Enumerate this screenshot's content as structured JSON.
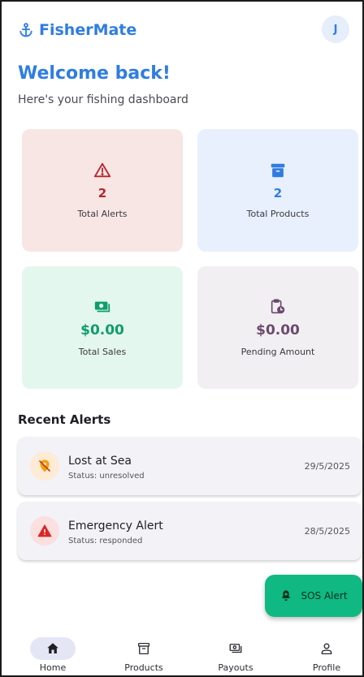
{
  "app": {
    "title": "FisherMate",
    "user_initial": "J"
  },
  "dashboard": {
    "welcome": "Welcome back!",
    "subtitle": "Here's your fishing dashboard"
  },
  "stats": [
    {
      "value": "2",
      "label": "Total Alerts",
      "icon": "warning-triangle-icon",
      "color": "#b3262c"
    },
    {
      "value": "2",
      "label": "Total Products",
      "icon": "archive-box-icon",
      "color": "#2f7de1"
    },
    {
      "value": "$0.00",
      "label": "Total Sales",
      "icon": "cash-icon",
      "color": "#0f9d6a"
    },
    {
      "value": "$0.00",
      "label": "Pending Amount",
      "icon": "clipboard-clock-icon",
      "color": "#6b4a6e"
    }
  ],
  "recent_alerts": {
    "title": "Recent Alerts",
    "items": [
      {
        "title": "Lost at Sea",
        "status": "Status: unresolved",
        "date": "29/5/2025",
        "icon": "location-off-icon"
      },
      {
        "title": "Emergency Alert",
        "status": "Status: responded",
        "date": "28/5/2025",
        "icon": "warning-filled-icon"
      }
    ]
  },
  "sos": {
    "label": "SOS Alert",
    "icon": "bell-alert-icon"
  },
  "nav": [
    {
      "label": "Home",
      "icon": "home-icon",
      "active": true
    },
    {
      "label": "Products",
      "icon": "archive-icon",
      "active": false
    },
    {
      "label": "Payouts",
      "icon": "cash-icon",
      "active": false
    },
    {
      "label": "Profile",
      "icon": "person-icon",
      "active": false
    }
  ]
}
